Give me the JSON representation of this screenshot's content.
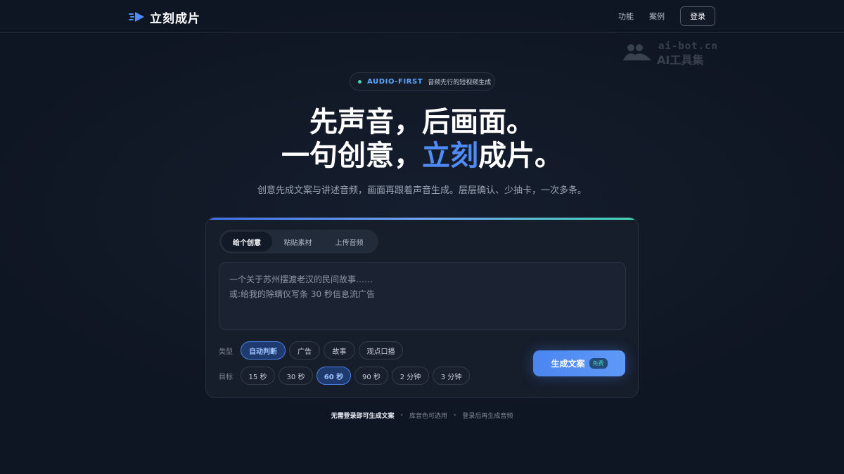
{
  "header": {
    "brand": "立刻成片",
    "nav": [
      "功能",
      "案例"
    ],
    "login_label": "登录"
  },
  "watermark": {
    "line1": "ai-bot.cn",
    "line2": "AI工具集"
  },
  "badge": {
    "strong": "AUDIO-FIRST",
    "text": "音频先行的短视频生成"
  },
  "hero": {
    "line1": "先声音，后画面。",
    "line2_before": "一句创意，",
    "line2_accent": "立刻",
    "line2_after": "成片。",
    "subtitle": "创意先成文案与讲述音频，画面再跟着声音生成。层层确认、少抽卡，一次多条。"
  },
  "card": {
    "tabs": [
      {
        "label": "给个创意",
        "active": true
      },
      {
        "label": "粘贴素材",
        "active": false
      },
      {
        "label": "上传音频",
        "active": false
      }
    ],
    "prompt": {
      "line1": "一个关于苏州摆渡老汉的民间故事……",
      "line2": "或:给我的除螨仪写条 30 秒信息流广告"
    },
    "type_row": {
      "label": "类型",
      "options": [
        "自动判断",
        "广告",
        "故事",
        "观点口播"
      ],
      "selected": "自动判断"
    },
    "target_row": {
      "label": "目标",
      "options": [
        "15 秒",
        "30 秒",
        "60 秒",
        "90 秒",
        "2 分钟",
        "3 分钟"
      ],
      "selected": "60 秒"
    },
    "generate": {
      "label": "生成文案",
      "tag": "免费"
    }
  },
  "footnote": {
    "items": [
      "无需登录即可生成文案",
      "库音色可选用",
      "登录后再生成音频"
    ]
  },
  "colors": {
    "accent": "#4f8cf7",
    "background": "#0f1623",
    "card": "#161e2c",
    "teal": "#3fd2b0"
  }
}
